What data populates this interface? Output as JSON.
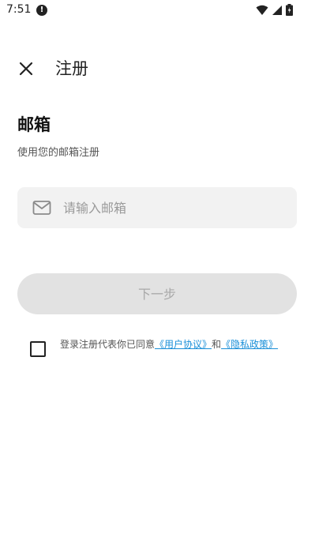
{
  "status_bar": {
    "time": "7:51",
    "alert_icon": "exclamation-circle-icon",
    "alert_glyph": "!",
    "icons": [
      "wifi-icon",
      "signal-icon",
      "battery-icon"
    ]
  },
  "app_bar": {
    "close_icon": "close-icon",
    "title": "注册"
  },
  "form": {
    "title": "邮箱",
    "subtitle": "使用您的邮箱注册",
    "email": {
      "icon": "mail-icon",
      "value": "",
      "placeholder": "请输入邮箱"
    },
    "next_button": "下一步",
    "next_enabled": false
  },
  "agreement": {
    "checked": false,
    "prefix": "登录注册代表你已同意",
    "user_agreement_link": "《用户协议》",
    "conjunction": "和",
    "privacy_policy_link": "《隐私政策》"
  },
  "colors": {
    "link": "#1a8fd8",
    "input_bg": "#f2f2f2",
    "button_disabled_bg": "#e2e2e2",
    "button_disabled_text": "#a8a8a8"
  }
}
